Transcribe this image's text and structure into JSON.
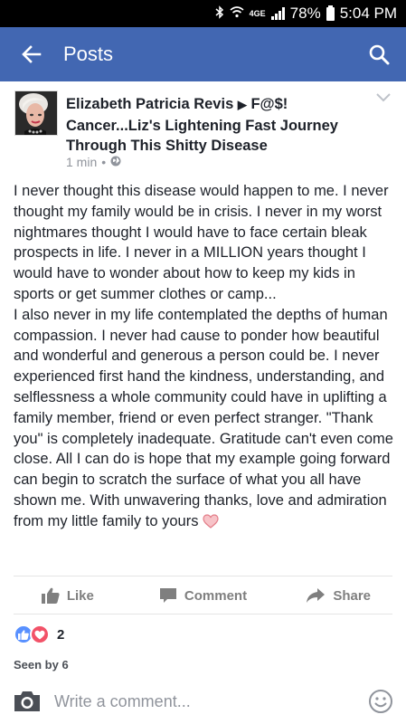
{
  "status_bar": {
    "network": "4GE",
    "battery": "78%",
    "time": "5:04 PM",
    "icons": [
      "bluetooth-icon",
      "wifi-icon",
      "signal-icon",
      "battery-icon"
    ]
  },
  "app_bar": {
    "title": "Posts",
    "background": "#4267b2",
    "back_icon": "arrow-left-icon",
    "search_icon": "search-icon"
  },
  "post": {
    "author": "Elizabeth Patricia Revis",
    "separator": "▶",
    "group": "F@$! Cancer...Liz's Lightening Fast Journey Through This Shitty Disease",
    "time_ago": "1 min",
    "dot": "•",
    "privacy_icon": "globe-icon",
    "menu_icon": "chevron-down-icon",
    "paragraph1": "I never thought this disease would happen to me. I never thought my family would be in crisis.  I never in my worst nightmares thought I would have to face certain bleak prospects in life. I never in a MILLION years thought I would have to wonder about how to keep my kids in sports or get summer clothes or camp...",
    "paragraph2": "I also never in my life contemplated the depths of human compassion. I never had cause to ponder how beautiful and wonderful and generous a person could be. I never experienced first hand the kindness, understanding, and selflessness a whole community could have in uplifting a family member, friend or even perfect stranger. \"Thank you\" is completely inadequate. Gratitude can't even come close. All I can do is hope that my example going forward can begin to scratch the surface of what you all have shown me. With unwavering thanks, love and admiration from my little family to yours"
  },
  "actions": {
    "like": "Like",
    "comment": "Comment",
    "share": "Share"
  },
  "reactions": {
    "count": "2",
    "types": [
      "like",
      "love"
    ]
  },
  "seen_by": "Seen by 6",
  "comment_bar": {
    "placeholder": "Write a comment...",
    "camera_icon": "camera-icon",
    "emoji_icon": "emoji-icon"
  }
}
